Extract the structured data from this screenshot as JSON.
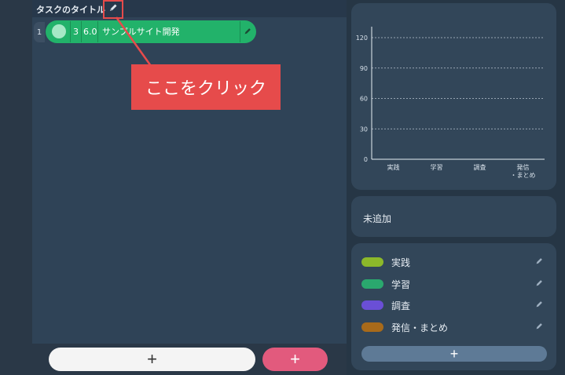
{
  "header": {
    "title": "タスクのタイトル"
  },
  "annotation": {
    "callout": "ここをクリック"
  },
  "task": {
    "index": "1",
    "count": "3",
    "hours": "6.0",
    "name": "サンプルサイト開発"
  },
  "buttons": {
    "add_plus": "+",
    "add_plus_pink": "+",
    "legend_add": "+"
  },
  "unadded": {
    "label": "未追加"
  },
  "legend": [
    {
      "label": "実践",
      "color": "#8cb82a"
    },
    {
      "label": "学習",
      "color": "#2aa86e"
    },
    {
      "label": "調査",
      "color": "#6a4fd6"
    },
    {
      "label": "発信・まとめ",
      "color": "#a86a1a"
    }
  ],
  "chart_data": {
    "type": "bar",
    "categories": [
      "実践",
      "学習",
      "調査",
      "発信\n・まとめ"
    ],
    "category_labels": [
      [
        "実践"
      ],
      [
        "学習"
      ],
      [
        "調査"
      ],
      [
        "発信",
        "・まとめ"
      ]
    ],
    "values": [
      0,
      0,
      0,
      0
    ],
    "ylim": [
      0,
      120
    ],
    "yticks": [
      0,
      30,
      60,
      90,
      120
    ],
    "grid": true
  },
  "colors": {
    "task_green": "#22b26a",
    "accent_red": "#e64b4b",
    "accent_pink": "#e25a7d"
  }
}
